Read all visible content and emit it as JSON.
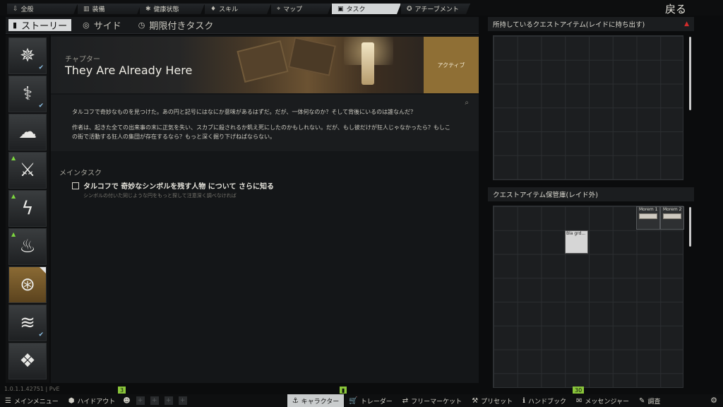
{
  "topnav": {
    "tabs": [
      {
        "icon": "person-arrow-icon",
        "glyph": "⇩",
        "label": "全般"
      },
      {
        "icon": "vest-icon",
        "glyph": "▥",
        "label": "装備"
      },
      {
        "icon": "health-icon",
        "glyph": "✱",
        "label": "健康状態"
      },
      {
        "icon": "skill-icon",
        "glyph": "♦",
        "label": "スキル"
      },
      {
        "icon": "map-pin-icon",
        "glyph": "⌖",
        "label": "マップ"
      },
      {
        "icon": "task-icon",
        "glyph": "▣",
        "label": "タスク"
      },
      {
        "icon": "achievement-icon",
        "glyph": "✪",
        "label": "アチーブメント"
      }
    ],
    "back_label": "戻る"
  },
  "subtabs": [
    {
      "icon": "bookmark-icon",
      "glyph": "▮",
      "label": "ストーリー"
    },
    {
      "icon": "target-icon",
      "glyph": "◎",
      "label": "サイド"
    },
    {
      "icon": "clock-icon",
      "glyph": "◷",
      "label": "期限付きタスク"
    }
  ],
  "traders": [
    {
      "name": "prapor",
      "glyph": "✵",
      "check": true,
      "warn": false
    },
    {
      "name": "therapist",
      "glyph": "⚕",
      "check": true,
      "warn": false
    },
    {
      "name": "fence",
      "glyph": "☁",
      "check": false,
      "warn": false
    },
    {
      "name": "skier",
      "glyph": "⚔",
      "check": false,
      "warn": true
    },
    {
      "name": "peacekeeper",
      "glyph": "ϟ",
      "check": false,
      "warn": true
    },
    {
      "name": "mechanic",
      "glyph": "♨",
      "check": false,
      "warn": true
    },
    {
      "name": "story",
      "glyph": "⊛",
      "check": false,
      "warn": false
    },
    {
      "name": "ragman",
      "glyph": "≋",
      "check": true,
      "warn": false
    },
    {
      "name": "jaeger",
      "glyph": "❖",
      "check": false,
      "warn": false
    }
  ],
  "quest": {
    "chapter_label": "チャプター",
    "title": "They Are Already Here",
    "status": "アクティブ",
    "description_1": "タルコフで奇妙なものを見つけた。あの円と記号にはなにか意味があるはずだ。だが、一体何なのか？そして背後にいるのは誰なんだ？",
    "description_2": "作者は、起きた全ての出来事の末に正気を失い、スカブに殺されるか飢え死にしたのかもしれない。だが、もし彼だけが狂人じゃなかったら？もしこの街で活動する狂人の集団が存在するなら？もっと深く掘り下げねばならない。",
    "main_task_label": "メインタスク",
    "task_text": "タルコフで 奇妙なシンボルを残す人物 について さらに知る",
    "task_hint": "シンボルの付いた同じような円をもっと探して注意深く調べなければ"
  },
  "right": {
    "inventory_title": "所持しているクエストアイテム(レイドに持ち出す)",
    "stash_title": "クエストアイテム保管庫(レイド外)",
    "items": {
      "tape1": "Morem 1",
      "tape2": "Morem 2",
      "paper": "Bla grd..."
    }
  },
  "bottombar": {
    "main_menu": "メインメニュー",
    "hideout": "ハイドアウト",
    "character": "キャラクター",
    "traders": "トレーダー",
    "flea": "フリーマーケット",
    "presets": "プリセット",
    "handbook": "ハンドブック",
    "messenger": "メッセンジャー",
    "survey": "調査",
    "badge_hideout": "3",
    "badge_character": "▮",
    "badge_handbook": "30",
    "version": "1.0.1.1.42751 | PvE"
  },
  "colors": {
    "accent_gold": "#8f6f35",
    "badge_green": "#8ac63a",
    "check_blue": "#8fc3e8",
    "warn_red": "#d12b2b"
  }
}
